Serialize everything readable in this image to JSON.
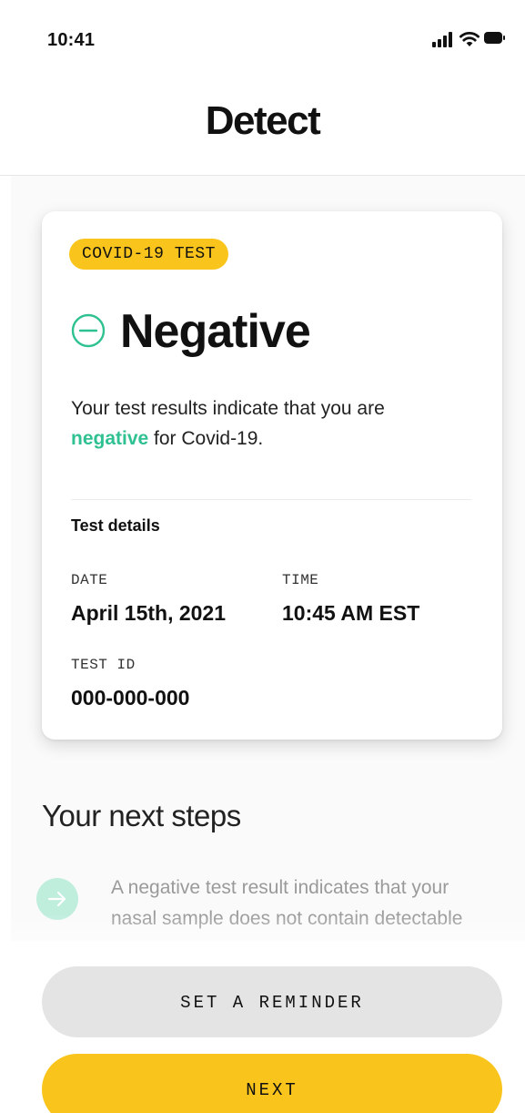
{
  "status_bar": {
    "time": "10:41",
    "icons": [
      "signal-icon",
      "wifi-icon",
      "battery-icon"
    ]
  },
  "header": {
    "title": "Detect"
  },
  "result_card": {
    "badge": "COVID-19 TEST",
    "status_icon": "minus-circle-icon",
    "status_title": "Negative",
    "message_prefix": "Your test results indicate that you are ",
    "message_highlight": "negative",
    "message_suffix": " for Covid-19.",
    "details_heading": "Test details",
    "date_label": "DATE",
    "date_value": "April 15th, 2021",
    "time_label": "TIME",
    "time_value": "10:45 AM EST",
    "test_id_label": "TEST ID",
    "test_id_value": "000-000-000"
  },
  "next_steps": {
    "heading": "Your next steps",
    "items": [
      {
        "icon": "arrow-right-icon",
        "text": "A negative test result indicates that your nasal sample does not contain detectable amounts of viral RNA (the"
      }
    ]
  },
  "actions": {
    "reminder_label": "SET A REMINDER",
    "next_label": "NEXT"
  },
  "colors": {
    "accent_yellow": "#f9c51d",
    "negative_green": "#2fc191",
    "step_icon_bg": "#bfeedd"
  }
}
